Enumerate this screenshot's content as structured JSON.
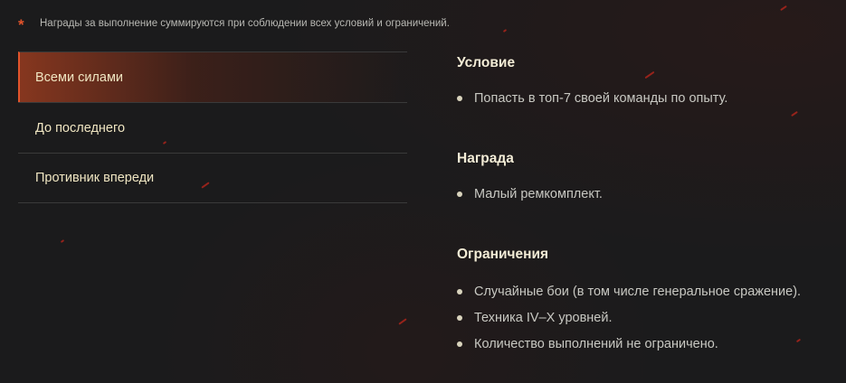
{
  "note": {
    "marker": "*",
    "text": "Награды за выполнение суммируются при соблюдении всех условий и ограничений."
  },
  "tabs": [
    {
      "label": "Всеми силами",
      "active": true
    },
    {
      "label": "До последнего",
      "active": false
    },
    {
      "label": "Противник впереди",
      "active": false
    }
  ],
  "sections": {
    "condition": {
      "title": "Условие",
      "items": [
        "Попасть в топ-7 своей команды по опыту."
      ]
    },
    "reward": {
      "title": "Награда",
      "items": [
        "Малый ремкомплект."
      ]
    },
    "limits": {
      "title": "Ограничения",
      "items": [
        "Случайные бои (в том числе генеральное сражение).",
        "Техника IV–X уровней.",
        "Количество выполнений не ограничено."
      ]
    }
  },
  "colors": {
    "background": "#1b1b1c",
    "accent": "#e2542b",
    "tab_text": "#f0e6c2",
    "body_text": "#c8c8c2"
  }
}
